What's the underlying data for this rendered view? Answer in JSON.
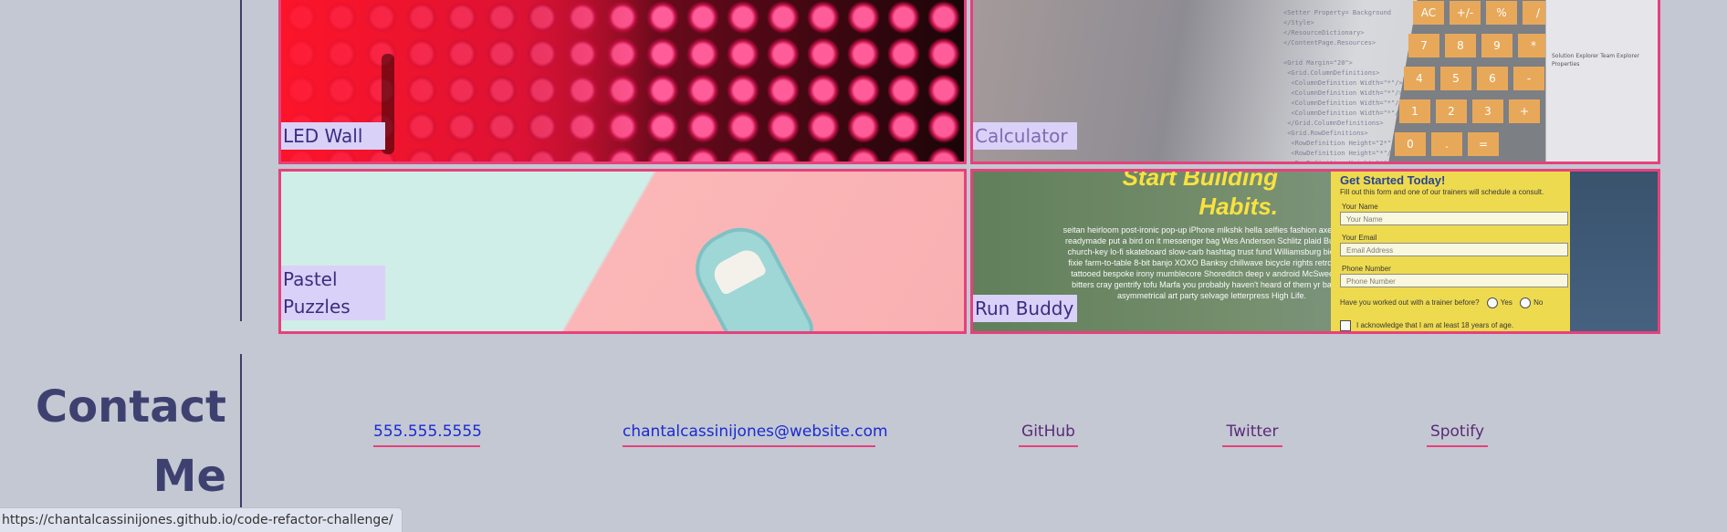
{
  "projects": [
    {
      "label": "LED Wall"
    },
    {
      "label": "Calculator"
    },
    {
      "label": "Pastel\nPuzzles",
      "lines": [
        "Pastel",
        "Puzzles"
      ]
    },
    {
      "label": "Run Buddy"
    }
  ],
  "run_buddy_preview": {
    "headline_1": "Start Building",
    "headline_2": "Habits.",
    "body": "seitan heirloom post-ironic pop-up iPhone mlkshk hella selfies fashion axe occupy readymade put a bird on it messenger bag Wes Anderson Schlitz plaid Bushwick church-key lo-fi skateboard slow-carb hashtag trust fund Williamsburg biodiesel fixie farm-to-table 8-bit banjo XOXO Banksy chillwave bicycle rights retro cliche tattooed bespoke irony mumblecore Shoreditch deep v android McSweeney's bitters cray gentrify tofu Marfa you probably haven't heard of them yr banh mi asymmetrical art party selvage letterpress High Life.",
    "form_title": "Get Started Today!",
    "form_subtitle": "Fill out this form and one of our trainers will schedule a consult.",
    "name_label": "Your Name",
    "name_placeholder": "Your Name",
    "email_label": "Your Email",
    "email_placeholder": "Email Address",
    "phone_label": "Phone Number",
    "phone_placeholder": "Phone Number",
    "question": "Have you worked out with a trainer before?",
    "yes": "Yes",
    "no": "No",
    "acknowledge": "I acknowledge that I am at least 18 years of age."
  },
  "calculator_preview": {
    "keys": [
      "AC",
      "+/-",
      "%",
      "/",
      "7",
      "8",
      "9",
      "*",
      "4",
      "5",
      "6",
      "-",
      "1",
      "2",
      "3",
      "+",
      "0",
      ".",
      "="
    ],
    "code": "<Setter Property= Background\n</Style>\n</ResourceDictionary>\n</ContentPage.Resources>\n\n<Grid Margin=\"20\">\n <Grid.ColumnDefinitions>\n  <ColumnDefinition Width=\"*\"/>\n  <ColumnDefinition Width=\"*\"/>\n  <ColumnDefinition Width=\"*\"/>\n  <ColumnDefinition Width=\"*\"/>\n </Grid.ColumnDefinitions>\n <Grid.RowDefinitions>\n  <RowDefinition Height=\"2*\"/>\n  <RowDefinition Height=\"*\"/>\n  <RowDefinition Height=\"*\"/>\n  <RowDefinition Height=\"*\"/>\n  <RowDefinition Height=\"*\"/>\n  <RowDefinition Height=\"*\"/>",
    "panel_items": [
      "Solution Explorer",
      "Team Explorer",
      "Properties"
    ]
  },
  "contact": {
    "title_line1": "Contact",
    "title_line2": "Me",
    "phone": "555.555.5555",
    "email": "chantalcassinijones@website.com",
    "github": "GitHub",
    "twitter": "Twitter",
    "spotify": "Spotify"
  },
  "status_url": "https://chantalcassinijones.github.io/code-refactor-challenge/",
  "colors": {
    "background": "#c4c8d2",
    "accent_border": "#e6417c",
    "label_bg": "#d9d1f7",
    "heading": "#3e4170",
    "link_blue": "#1a2ad4",
    "link_purple": "#5a2a7a"
  }
}
